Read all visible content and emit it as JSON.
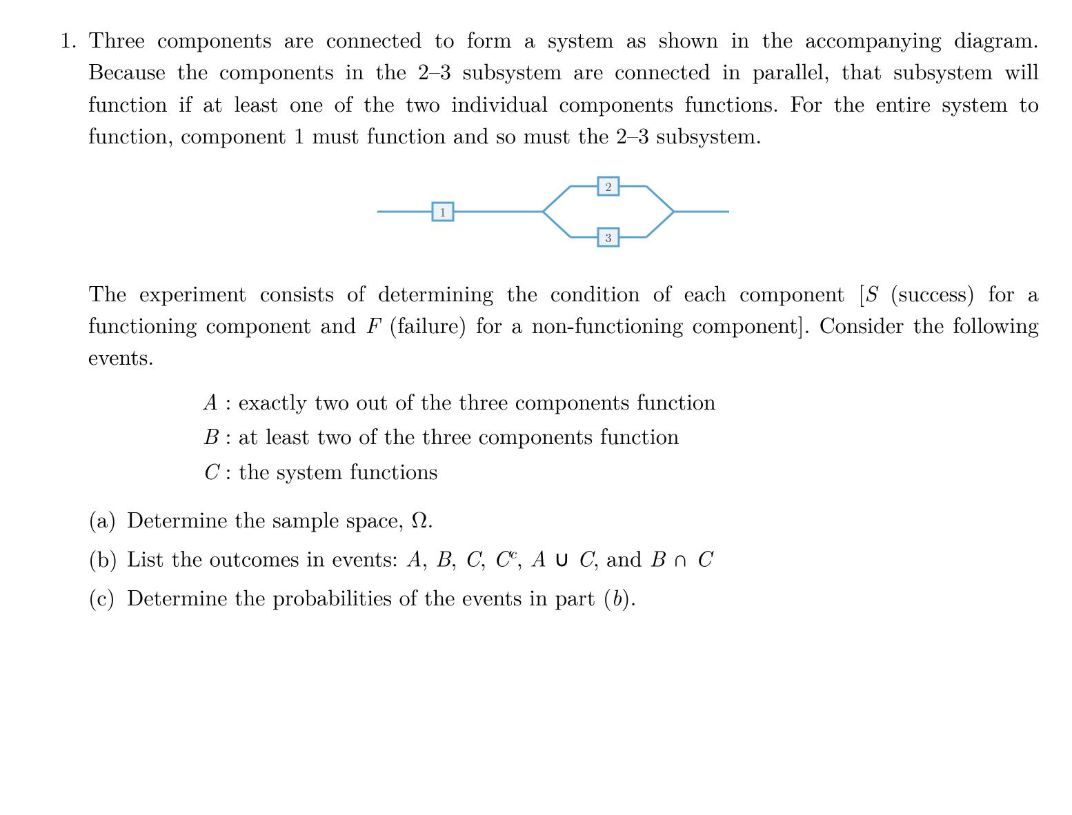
{
  "problem_number": "1.",
  "paragraph1": "Three components are connected to form a system as shown in the accompanying diagram. Because the components in the 2–3 subsystem are connected in parallel, that subsystem will function if at least one of the two individual components functions. For the entire system to function, component 1 must function and so must the 2–3 subsystem.",
  "diagram": {
    "box1": "1",
    "box2": "2",
    "box3": "3",
    "line_color": "#5aa3d0",
    "box_border": "#5aa3d0",
    "box_fill": "#eaf3fa",
    "text_color": "#4a4a4a"
  },
  "paragraph2_parts": {
    "pre": "The experiment consists of determining the condition of each component [",
    "S": "S",
    "mid1": " (success) for a functioning component and ",
    "F": "F",
    "mid2": " (failure) for a non-functioning component]. Consider the following events."
  },
  "events": [
    {
      "label": "A",
      "text": "exactly two out of the three components function"
    },
    {
      "label": "B",
      "text": "at least two of the three components function"
    },
    {
      "label": "C",
      "text": "the system functions"
    }
  ],
  "subparts": {
    "a": {
      "label": "(a)",
      "pre": "Determine the sample space, ",
      "omega": "Ω",
      "post": "."
    },
    "b": {
      "label": "(b)",
      "pre": "List the outcomes in events: ",
      "seq": [
        "A",
        ", ",
        "B",
        ", ",
        "C",
        ", ",
        "C",
        "c",
        ", ",
        "A",
        " ∪ ",
        "C",
        ", and ",
        "B",
        " ∩ ",
        "C"
      ]
    },
    "c": {
      "label": "(c)",
      "pre": "Determine the probabilities of the events in part (",
      "b": "b",
      "post": ")."
    }
  }
}
